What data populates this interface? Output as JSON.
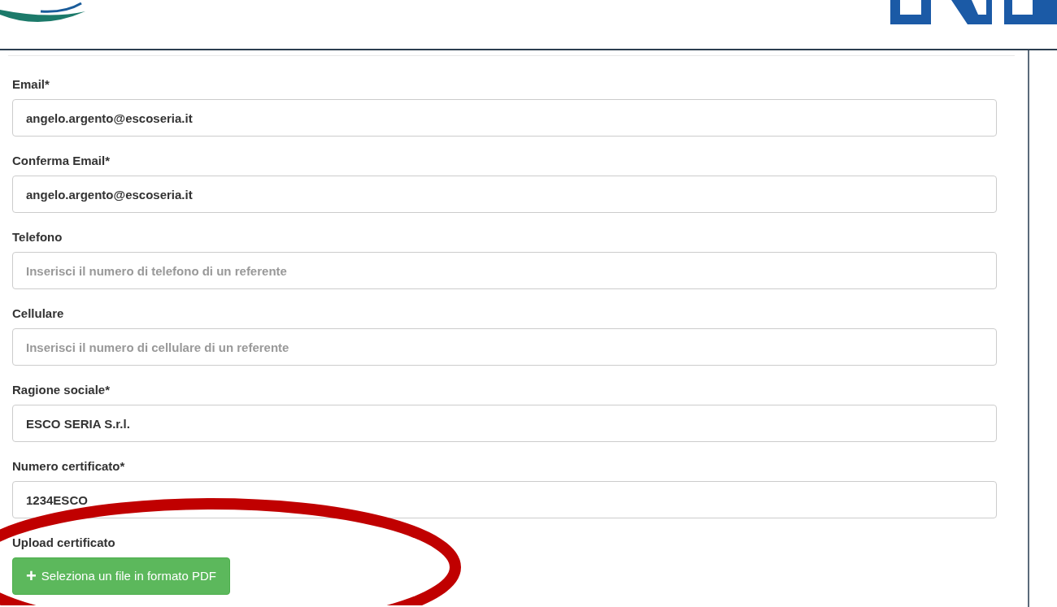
{
  "fields": [
    {
      "label": "Email*",
      "value": "angelo.argento@escoseria.it"
    },
    {
      "label": "Conferma Email*",
      "value": "angelo.argento@escoseria.it"
    },
    {
      "label": "Telefono",
      "placeholder": "Inserisci il numero di telefono di un referente"
    },
    {
      "label": "Cellulare",
      "placeholder": "Inserisci il numero di cellulare di un referente"
    },
    {
      "label": "Ragione sociale*",
      "value": "ESCO SERIA S.r.l."
    },
    {
      "label": "Numero certificato*",
      "value": "1234ESCO"
    }
  ],
  "upload": {
    "label": "Upload certificato",
    "button": "Seleziona un file in formato PDF",
    "icon": "+"
  },
  "annotation": {
    "kind": "ellipse",
    "color": "#c00000"
  }
}
